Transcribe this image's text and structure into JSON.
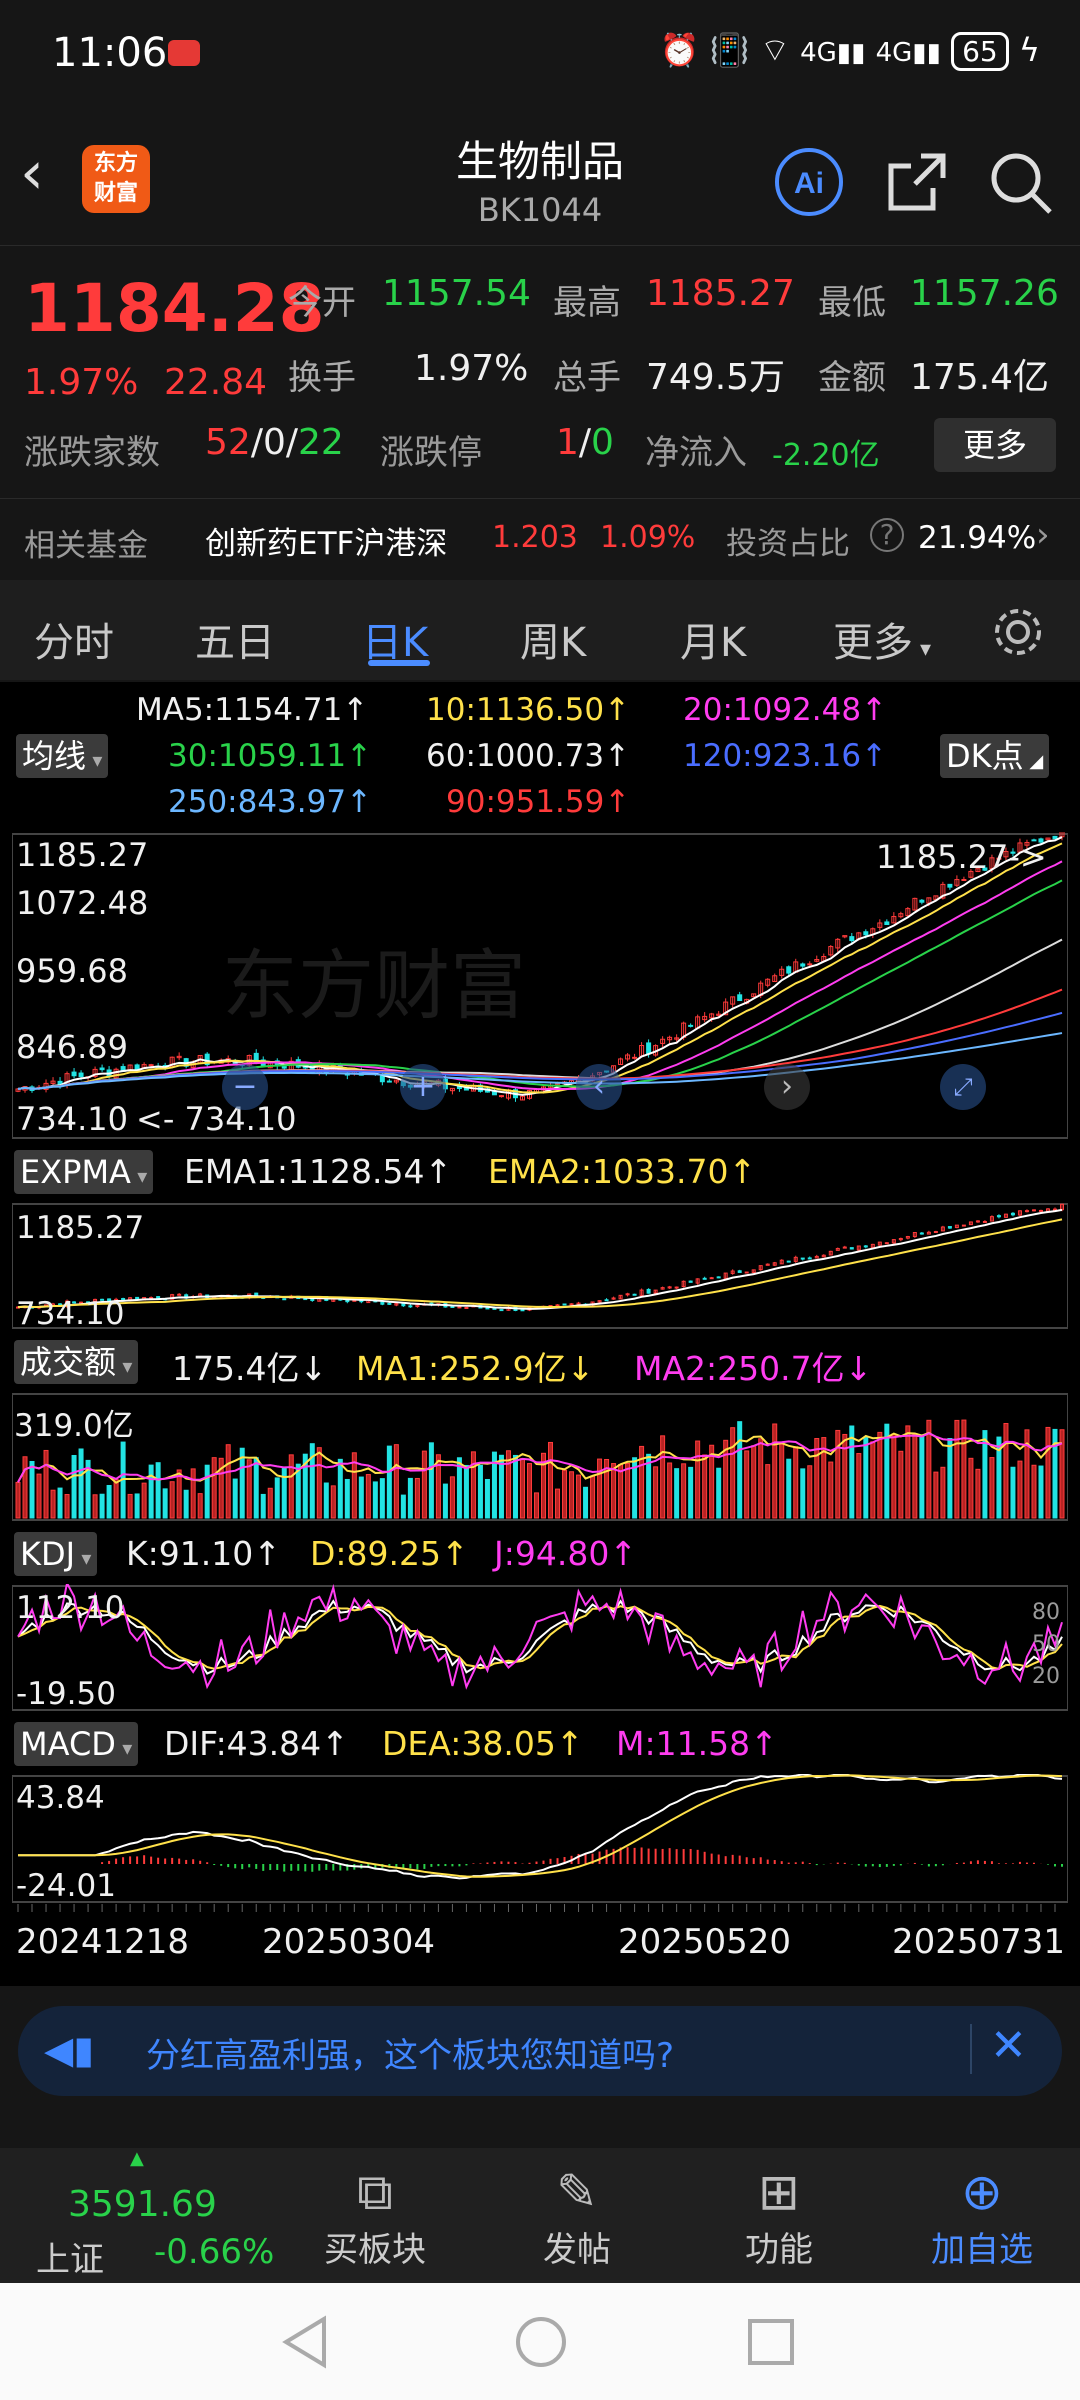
{
  "status_bar": {
    "time": "11:06",
    "battery": "65",
    "network": "4G"
  },
  "header": {
    "title": "生物制品",
    "code": "BK1044",
    "logo_text_1": "东方",
    "logo_text_2": "财富",
    "ai_label": "Ai"
  },
  "quote": {
    "price": "1184.28",
    "change_pct": "1.97%",
    "change": "22.84",
    "open_label": "今开",
    "open": "1157.54",
    "high_label": "最高",
    "high": "1185.27",
    "low_label": "最低",
    "low": "1157.26",
    "turnover_label": "换手",
    "turnover": "1.97%",
    "volume_label": "总手",
    "volume": "749.5万",
    "amount_label": "金额",
    "amount": "175.4亿",
    "updown_label": "涨跌家数",
    "up_count": "52",
    "flat_count": "0",
    "down_count": "22",
    "limit_label": "涨跌停",
    "limit_up": "1",
    "limit_down": "0",
    "inflow_label": "净流入",
    "inflow": "-2.20亿",
    "more_button": "更多"
  },
  "fund": {
    "label": "相关基金",
    "name": "创新药ETF沪港深",
    "price": "1.203",
    "pct": "1.09%",
    "ratio_label": "投资占比",
    "ratio": "21.94%"
  },
  "tabs": [
    "分时",
    "五日",
    "日K",
    "周K",
    "月K",
    "更多"
  ],
  "active_tab": "日K",
  "ma_legend": {
    "selector": "均线",
    "dk_button": "DK点",
    "ma5": "MA5:1154.71↑",
    "ma10": "10:1136.50↑",
    "ma20": "20:1092.48↑",
    "ma30": "30:1059.11↑",
    "ma60": "60:1000.73↑",
    "ma120": "120:923.16↑",
    "ma250": "250:843.97↑",
    "ma90": "90:951.59↑"
  },
  "main_chart": {
    "y_labels": [
      "1185.27",
      "1072.48",
      "959.68",
      "846.89",
      "734.10"
    ],
    "max_marker": "1185.27->",
    "min_marker": "<- 734.10",
    "watermark": "东方财富"
  },
  "expma": {
    "selector": "EXPMA",
    "ema1": "EMA1:1128.54↑",
    "ema2": "EMA2:1033.70↑",
    "y_top": "1185.27",
    "y_bottom": "734.10"
  },
  "volume": {
    "selector": "成交额",
    "current": "175.4亿↓",
    "ma1": "MA1:252.9亿↓",
    "ma2": "MA2:250.7亿↓",
    "y_top": "319.0亿"
  },
  "kdj": {
    "selector": "KDJ",
    "k": "K:91.10↑",
    "d": "D:89.25↑",
    "j": "J:94.80↑",
    "y_top": "112.10",
    "y_bottom": "-19.50",
    "levels": [
      "80",
      "50",
      "20"
    ]
  },
  "macd": {
    "selector": "MACD",
    "dif": "DIF:43.84↑",
    "dea": "DEA:38.05↑",
    "m": "M:11.58↑",
    "y_top": "43.84",
    "y_bottom": "-24.01"
  },
  "x_dates": [
    "20241218",
    "20250304",
    "20250520",
    "20250731"
  ],
  "banner": {
    "text": "分红高盈利强，这个板块您知道吗?"
  },
  "bottom_nav": {
    "index_value": "3591.69",
    "index_name": "上证",
    "index_change": "-0.66%",
    "items": [
      "买板块",
      "发帖",
      "功能",
      "加自选"
    ]
  },
  "colors": {
    "up": "#ff3b3b",
    "down": "#29d24a",
    "accent": "#4b8cff"
  }
}
